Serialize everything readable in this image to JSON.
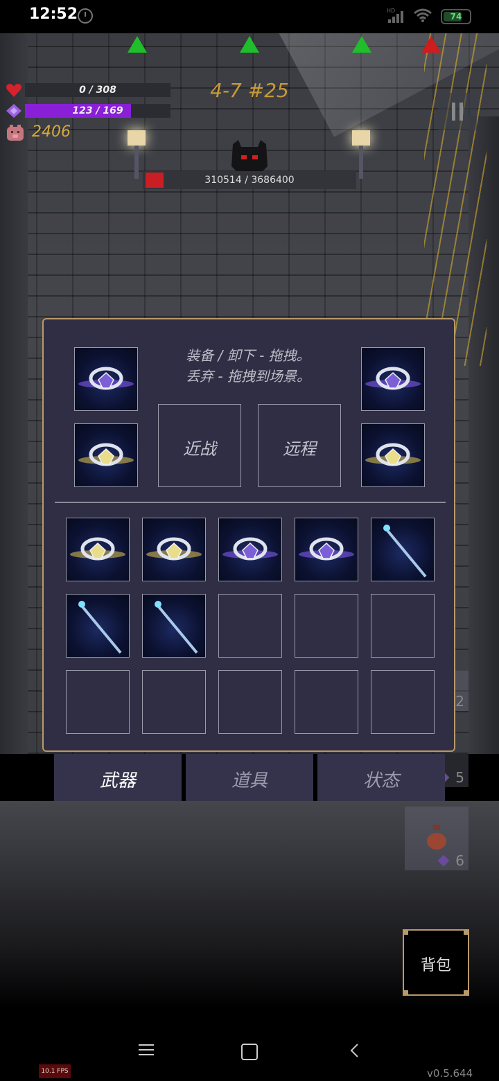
{
  "status_bar": {
    "time": "12:52",
    "battery": "74",
    "battery_pct": 74,
    "network_tag": "HD"
  },
  "hud": {
    "hp_text": "0 / 308",
    "hp_fraction": 0.0,
    "mana_text": "123 / 169",
    "mana_fraction": 0.728,
    "gold": "2406",
    "level_label": "4-7 #25",
    "boss_hp_text": "310514 / 3686400",
    "boss_hp_fraction": 0.084,
    "markers": [
      "green",
      "green",
      "green",
      "red"
    ]
  },
  "inventory": {
    "hint_line1": "装备 / 卸下 - 拖拽。",
    "hint_line2": "丢弃 - 拖拽到场景。",
    "melee_label": "近战",
    "ranged_label": "远程",
    "equipped": {
      "left_top": "ring-purple-swirl",
      "left_bottom": "ring-gold-cross",
      "right_top": "ring-purple-swirl",
      "right_bottom": "ring-gold-cross"
    },
    "bag": [
      [
        "ring-gold-shell",
        "ring-gold-shell",
        "ring-purple-flower",
        "ring-purple-cloud",
        "staff-blue"
      ],
      [
        "staff-blue",
        "staff-blue",
        "",
        "",
        ""
      ],
      [
        "",
        "",
        "",
        "",
        ""
      ]
    ]
  },
  "tabs": {
    "weapons": "武器",
    "items": "道具",
    "status": "状态"
  },
  "side_slots": {
    "slot2": "2",
    "slot5": "5",
    "slot6": "6"
  },
  "backpack_label": "背包",
  "fps": "10.1 FPS",
  "version": "v0.5.644",
  "colors": {
    "panel_bg": "#2f2e44",
    "panel_border": "#b89a6a",
    "hp_red": "#c81e24",
    "mana_purple": "#8a1fd8",
    "gold_text": "#d6a93a"
  }
}
